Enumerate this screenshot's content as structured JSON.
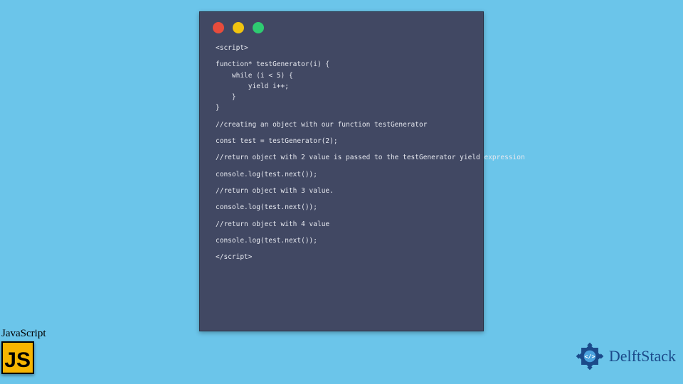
{
  "code": {
    "lines": [
      "<script>",
      "function* testGenerator(i) {",
      "    while (i < 5) {",
      "        yield i++;",
      "    }",
      "",
      "}",
      "//creating an object with our function testGenerator",
      "const test = testGenerator(2);",
      "//return object with 2 value is passed to the testGenerator yield expression",
      "console.log(test.next());",
      "//return object with 3 value.",
      "console.log(test.next());",
      "//return object with 4 value",
      "console.log(test.next());",
      "</script>"
    ]
  },
  "js_badge": {
    "label": "JavaScript",
    "logo_text": "JS"
  },
  "delft": {
    "text": "DelftStack"
  }
}
